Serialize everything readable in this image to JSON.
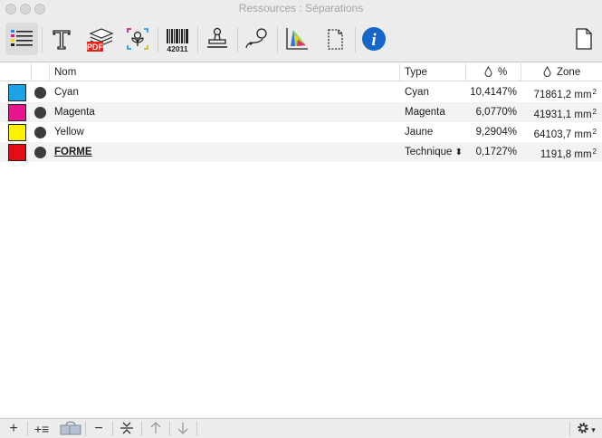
{
  "window": {
    "title": "Ressources : Séparations"
  },
  "toolbar": {
    "buttons": [
      {
        "name": "list-icon",
        "active": true
      },
      {
        "name": "text-icon"
      },
      {
        "name": "pdf-layers-icon",
        "badge": "PDF"
      },
      {
        "name": "image-flower-icon"
      },
      {
        "name": "barcode-icon",
        "caption": "42011"
      },
      {
        "name": "stamp-icon"
      },
      {
        "name": "path-curve-icon"
      },
      {
        "name": "color-gamut-icon"
      },
      {
        "name": "crop-page-icon"
      },
      {
        "name": "info-icon",
        "glyph": "i"
      },
      {
        "name": "document-icon"
      }
    ]
  },
  "table": {
    "columns": {
      "name": "Nom",
      "type": "Type",
      "percent": "%",
      "zone": "Zone"
    },
    "rows": [
      {
        "color": "#1aa3e6",
        "name": "Cyan",
        "type": "Cyan",
        "percent": "10,4147%",
        "zone": "71861,2 mm",
        "unit_sup": "2"
      },
      {
        "color": "#e6158c",
        "name": "Magenta",
        "type": "Magenta",
        "percent": "6,0770%",
        "zone": "41931,1 mm",
        "unit_sup": "2"
      },
      {
        "color": "#fff200",
        "name": "Yellow",
        "type": "Jaune",
        "percent": "9,2904%",
        "zone": "64103,7 mm",
        "unit_sup": "2"
      },
      {
        "color": "#e30d16",
        "name": "FORME",
        "type": "Technique",
        "type_arrows": "⬍",
        "percent": "0,1727%",
        "zone": "1191,8 mm",
        "unit_sup": "2"
      }
    ]
  },
  "bottombar": {
    "add": "+",
    "add_list": "+≡",
    "remove": "−",
    "gear_arrow": "▾"
  }
}
